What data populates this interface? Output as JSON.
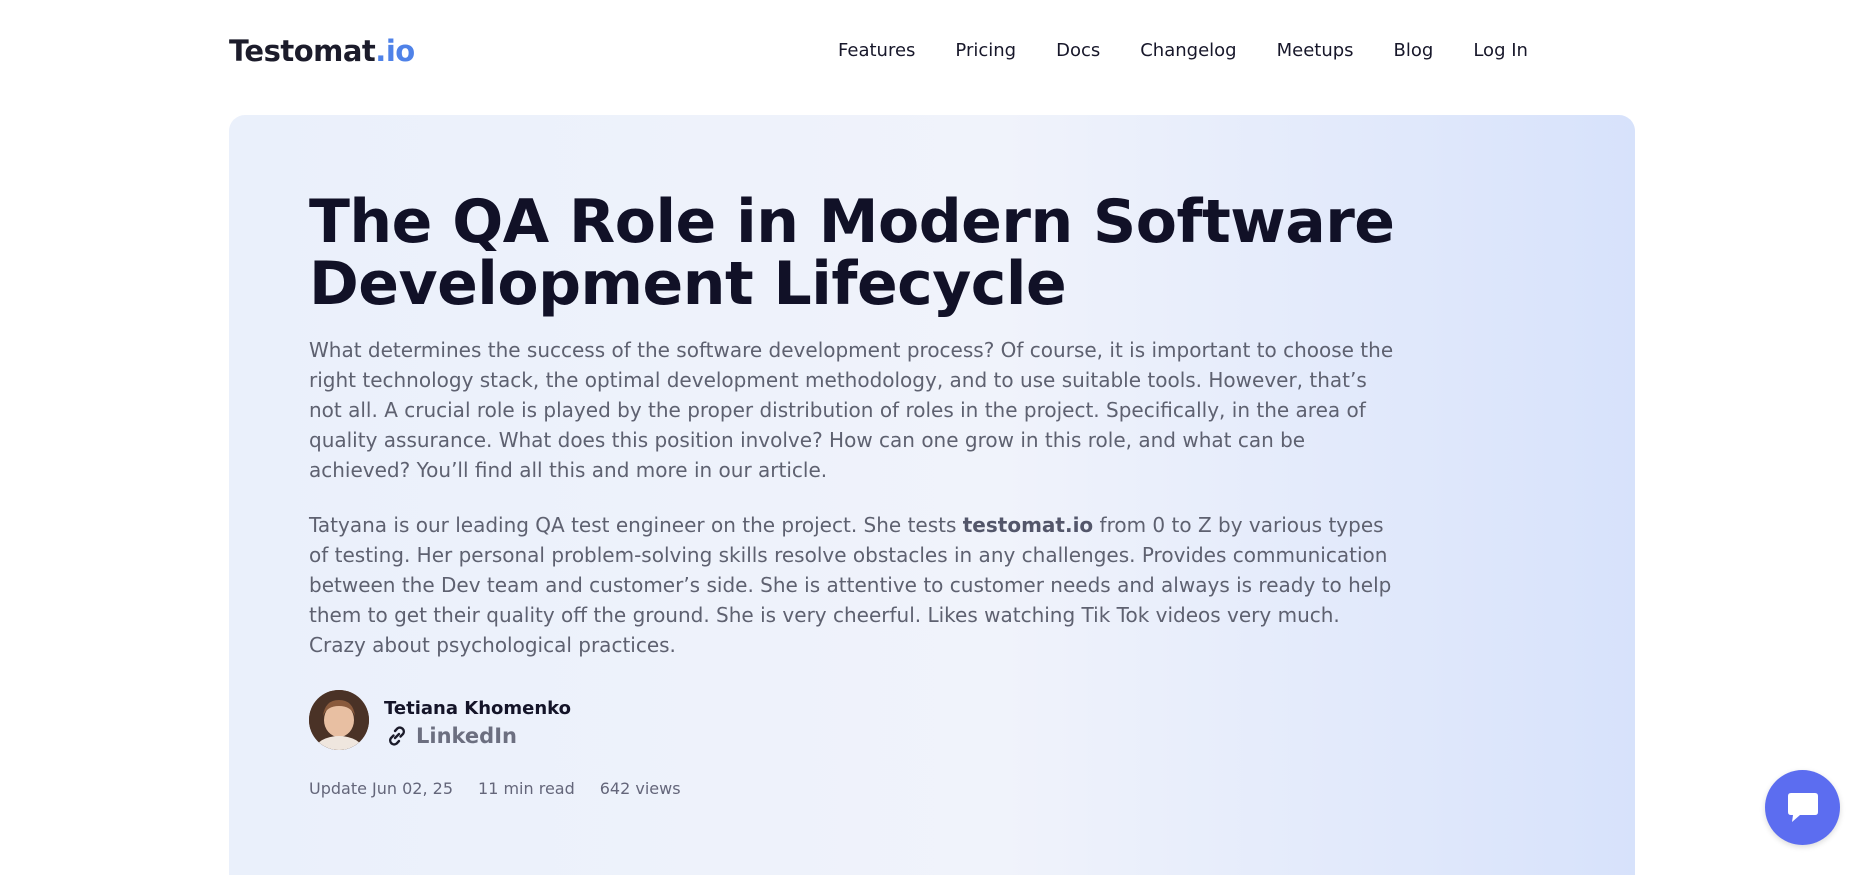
{
  "header": {
    "logo": {
      "main": "Testomat",
      "accent": ".io"
    },
    "nav": [
      {
        "label": "Features"
      },
      {
        "label": "Pricing"
      },
      {
        "label": "Docs"
      },
      {
        "label": "Changelog"
      },
      {
        "label": "Meetups"
      },
      {
        "label": "Blog"
      },
      {
        "label": "Log In"
      }
    ]
  },
  "article": {
    "title": "The QA Role in Modern Software Development Lifecycle",
    "intro": "What determines the success of the software development process? Of course, it is important to choose the right technology stack, the optimal development methodology, and to use suitable tools. However, that’s not all. A crucial role is played by the proper distribution of roles in the project. Specifically, in the area of quality assurance. What does this position involve? How can one grow in this role, and what can be achieved? You’ll find all this and more in our article.",
    "bio": {
      "before": "Tatyana is our leading QA test engineer on the project. She tests ",
      "bold": "testomat.io",
      "after": " from 0 to Z by various types of testing. Her personal problem-solving skills resolve obstacles in any challenges. Provides communication between the Dev team and customer’s side. She is attentive to customer needs and always is ready to help them to get their quality off the ground. She is very cheerful. Likes watching Tik Tok videos very much. Crazy about psychological practices."
    },
    "author": {
      "name": "Tetiana Khomenko",
      "link_label": "LinkedIn",
      "link_icon": "link-icon"
    },
    "meta": {
      "updated": "Update Jun 02, 25",
      "read_time": "11 min read",
      "views": "642 views"
    }
  },
  "chat": {
    "icon": "chat-bubble-icon"
  },
  "colors": {
    "accent": "#4f82e8",
    "chat_button": "#5c6df0",
    "title": "#111127",
    "body_text": "#5e6170"
  }
}
